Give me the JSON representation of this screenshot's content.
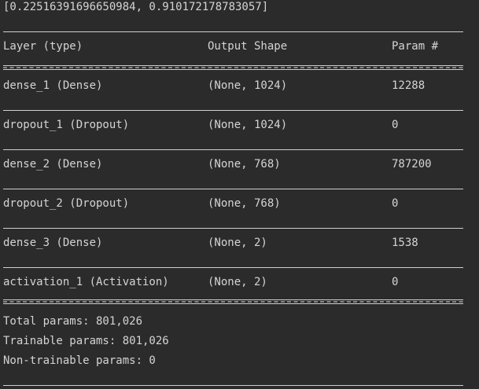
{
  "output_line": "[0.22516391696650984, 0.910172178783057]",
  "header": {
    "layer": "Layer (type)",
    "output_shape": "Output Shape",
    "params": "Param #"
  },
  "layers": [
    {
      "name": "dense_1 (Dense)",
      "shape": "(None, 1024)",
      "params": "12288"
    },
    {
      "name": "dropout_1 (Dropout)",
      "shape": "(None, 1024)",
      "params": "0"
    },
    {
      "name": "dense_2 (Dense)",
      "shape": "(None, 768)",
      "params": "787200"
    },
    {
      "name": "dropout_2 (Dropout)",
      "shape": "(None, 768)",
      "params": "0"
    },
    {
      "name": "dense_3 (Dense)",
      "shape": "(None, 2)",
      "params": "1538"
    },
    {
      "name": "activation_1 (Activation)",
      "shape": "(None, 2)",
      "params": "0"
    }
  ],
  "summary": {
    "total": "Total params: 801,026",
    "trainable": "Trainable params: 801,026",
    "non_trainable": "Non-trainable params: 0"
  }
}
